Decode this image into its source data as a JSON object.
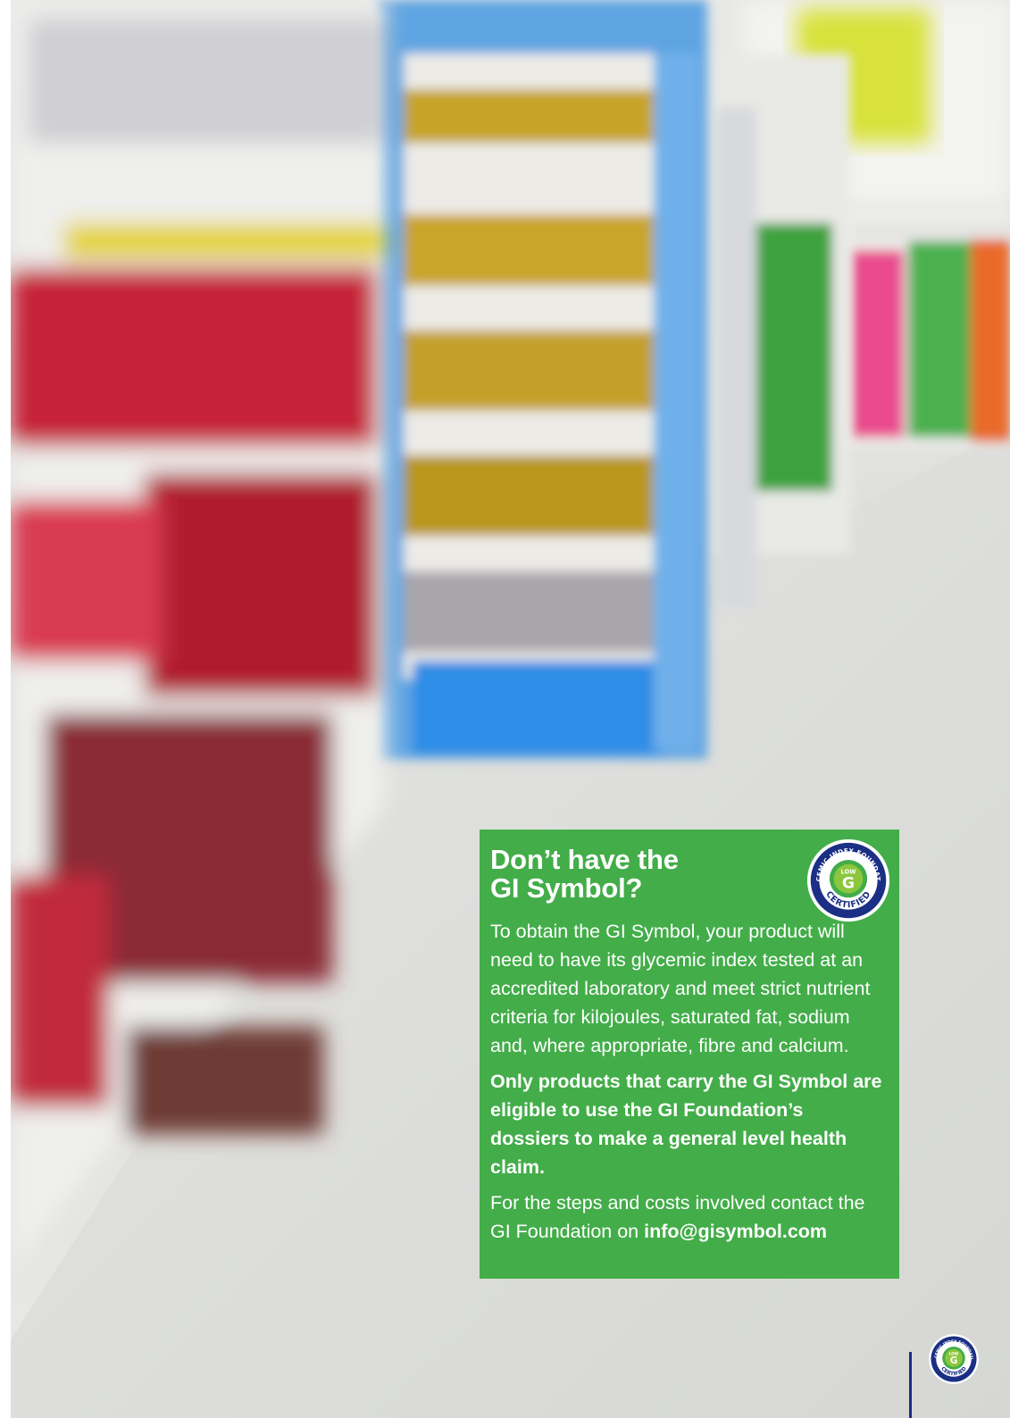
{
  "panel": {
    "heading_line1": "Don’t have the",
    "heading_line2": "GI Symbol?",
    "intro": "To obtain the GI Symbol, your product will need to have its glycemic index tested at an accredited laboratory and meet strict nutrient criteria for kilojoules, saturated fat, sodium and, where appropriate, fibre and calcium.",
    "claim": "Only products that carry the GI Symbol are eligible to use the GI Foundation’s dossiers to make a general level health claim.",
    "contact_prefix": "For the steps and costs involved contact the GI Foundation on ",
    "contact_email": "info@gisymbol.com"
  },
  "badge": {
    "arc_text": "GLYCEMIC INDEX FOUNDATION",
    "low": "LOW",
    "letter": "G",
    "certified": "CERTIFIED",
    "icon": "gi-certified-logo"
  },
  "colors": {
    "panel_green": "#43ad49",
    "badge_blue": "#1b2f85",
    "badge_lime": "#8cc63f"
  }
}
